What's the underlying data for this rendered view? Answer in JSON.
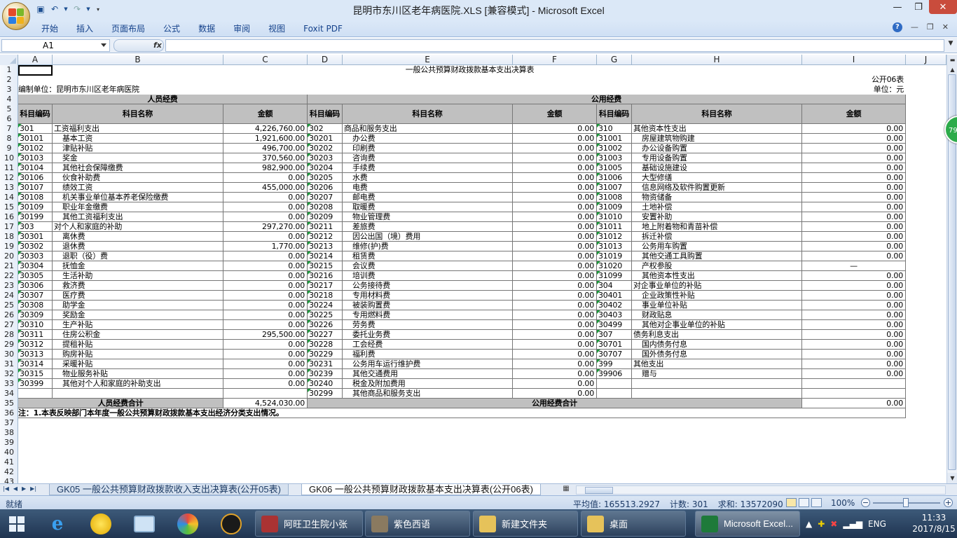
{
  "window": {
    "title": "昆明市东川区老年病医院.XLS  [兼容模式] - Microsoft Excel"
  },
  "ribbon": {
    "tabs": [
      "开始",
      "插入",
      "页面布局",
      "公式",
      "数据",
      "审阅",
      "视图",
      "Foxit PDF"
    ]
  },
  "formula": {
    "namebox": "A1",
    "fx": "fx",
    "content": ""
  },
  "columns": [
    "A",
    "B",
    "C",
    "D",
    "E",
    "F",
    "G",
    "H",
    "I",
    "J"
  ],
  "rows_visible": [
    "1",
    "2",
    "3",
    "4",
    "5",
    "6",
    "7",
    "8",
    "9",
    "10",
    "11",
    "12",
    "13",
    "14",
    "15",
    "16",
    "17",
    "18",
    "19",
    "20",
    "21",
    "22",
    "23",
    "24",
    "25",
    "26",
    "27",
    "28",
    "29",
    "30",
    "31",
    "32",
    "33",
    "34",
    "35",
    "36",
    "37",
    "38",
    "39",
    "40",
    "41",
    "42",
    "43"
  ],
  "sheet": {
    "title": "一般公共预算财政拨款基本支出决算表",
    "form_no": "公开06表",
    "unit_label": "编制单位：昆明市东川区老年病医院",
    "unit_of_measure": "单位：元",
    "personnel_header": "人员经费",
    "public_header": "公用经费",
    "col_code": "科目编码",
    "col_name": "科目名称",
    "col_amount": "金额",
    "personnel_total_label": "人员经费合计",
    "personnel_total": "4,524,030.00",
    "public_total_label": "公用经费合计",
    "public_total": "0.00",
    "note": "注：1.本表反映部门本年度一般公共预算财政拨款基本支出经济分类支出情况。",
    "rows": [
      [
        [
          "301",
          "工资福利支出",
          "4,226,760.00"
        ],
        [
          "302",
          "商品和服务支出",
          "0.00"
        ],
        [
          "310",
          "其他资本性支出",
          "0.00"
        ]
      ],
      [
        [
          "30101",
          "基本工资",
          "1,921,600.00"
        ],
        [
          "30201",
          "办公费",
          "0.00"
        ],
        [
          "31001",
          "房屋建筑物购建",
          "0.00"
        ]
      ],
      [
        [
          "30102",
          "津贴补贴",
          "496,700.00"
        ],
        [
          "30202",
          "印刷费",
          "0.00"
        ],
        [
          "31002",
          "办公设备购置",
          "0.00"
        ]
      ],
      [
        [
          "30103",
          "奖金",
          "370,560.00"
        ],
        [
          "30203",
          "咨询费",
          "0.00"
        ],
        [
          "31003",
          "专用设备购置",
          "0.00"
        ]
      ],
      [
        [
          "30104",
          "其他社会保障缴费",
          "982,900.00"
        ],
        [
          "30204",
          "手续费",
          "0.00"
        ],
        [
          "31005",
          "基础设施建设",
          "0.00"
        ]
      ],
      [
        [
          "30106",
          "伙食补助费",
          "0.00"
        ],
        [
          "30205",
          "水费",
          "0.00"
        ],
        [
          "31006",
          "大型修缮",
          "0.00"
        ]
      ],
      [
        [
          "30107",
          "绩效工资",
          "455,000.00"
        ],
        [
          "30206",
          "电费",
          "0.00"
        ],
        [
          "31007",
          "信息网络及软件购置更新",
          "0.00"
        ]
      ],
      [
        [
          "30108",
          "机关事业单位基本养老保险缴费",
          "0.00"
        ],
        [
          "30207",
          "邮电费",
          "0.00"
        ],
        [
          "31008",
          "物资储备",
          "0.00"
        ]
      ],
      [
        [
          "30109",
          "职业年金缴费",
          "0.00"
        ],
        [
          "30208",
          "取暖费",
          "0.00"
        ],
        [
          "31009",
          "土地补偿",
          "0.00"
        ]
      ],
      [
        [
          "30199",
          "其他工资福利支出",
          "0.00"
        ],
        [
          "30209",
          "物业管理费",
          "0.00"
        ],
        [
          "31010",
          "安置补助",
          "0.00"
        ]
      ],
      [
        [
          "303",
          "对个人和家庭的补助",
          "297,270.00"
        ],
        [
          "30211",
          "差旅费",
          "0.00"
        ],
        [
          "31011",
          "地上附着物和青苗补偿",
          "0.00"
        ]
      ],
      [
        [
          "30301",
          "离休费",
          "0.00"
        ],
        [
          "30212",
          "因公出国（境）费用",
          "0.00"
        ],
        [
          "31012",
          "拆迁补偿",
          "0.00"
        ]
      ],
      [
        [
          "30302",
          "退休费",
          "1,770.00"
        ],
        [
          "30213",
          "维修(护)费",
          "0.00"
        ],
        [
          "31013",
          "公务用车购置",
          "0.00"
        ]
      ],
      [
        [
          "30303",
          "退职（役）费",
          "0.00"
        ],
        [
          "30214",
          "租赁费",
          "0.00"
        ],
        [
          "31019",
          "其他交通工具购置",
          "0.00"
        ]
      ],
      [
        [
          "30304",
          "抚恤金",
          "0.00"
        ],
        [
          "30215",
          "会议费",
          "0.00"
        ],
        [
          "31020",
          "产权参股",
          "—"
        ]
      ],
      [
        [
          "30305",
          "生活补助",
          "0.00"
        ],
        [
          "30216",
          "培训费",
          "0.00"
        ],
        [
          "31099",
          "其他资本性支出",
          "0.00"
        ]
      ],
      [
        [
          "30306",
          "救济费",
          "0.00"
        ],
        [
          "30217",
          "公务接待费",
          "0.00"
        ],
        [
          "304",
          "对企事业单位的补贴",
          "0.00"
        ]
      ],
      [
        [
          "30307",
          "医疗费",
          "0.00"
        ],
        [
          "30218",
          "专用材料费",
          "0.00"
        ],
        [
          "30401",
          "企业政策性补贴",
          "0.00"
        ]
      ],
      [
        [
          "30308",
          "助学金",
          "0.00"
        ],
        [
          "30224",
          "被装购置费",
          "0.00"
        ],
        [
          "30402",
          "事业单位补贴",
          "0.00"
        ]
      ],
      [
        [
          "30309",
          "奖励金",
          "0.00"
        ],
        [
          "30225",
          "专用燃料费",
          "0.00"
        ],
        [
          "30403",
          "财政贴息",
          "0.00"
        ]
      ],
      [
        [
          "30310",
          "生产补贴",
          "0.00"
        ],
        [
          "30226",
          "劳务费",
          "0.00"
        ],
        [
          "30499",
          "其他对企事业单位的补贴",
          "0.00"
        ]
      ],
      [
        [
          "30311",
          "住房公积金",
          "295,500.00"
        ],
        [
          "30227",
          "委托业务费",
          "0.00"
        ],
        [
          "307",
          "债务利息支出",
          "0.00"
        ]
      ],
      [
        [
          "30312",
          "提租补贴",
          "0.00"
        ],
        [
          "30228",
          "工会经费",
          "0.00"
        ],
        [
          "30701",
          "国内债务付息",
          "0.00"
        ]
      ],
      [
        [
          "30313",
          "购房补贴",
          "0.00"
        ],
        [
          "30229",
          "福利费",
          "0.00"
        ],
        [
          "30707",
          "国外债务付息",
          "0.00"
        ]
      ],
      [
        [
          "30314",
          "采暖补贴",
          "0.00"
        ],
        [
          "30231",
          "公务用车运行维护费",
          "0.00"
        ],
        [
          "399",
          "其他支出",
          "0.00"
        ]
      ],
      [
        [
          "30315",
          "物业服务补贴",
          "0.00"
        ],
        [
          "30239",
          "其他交通费用",
          "0.00"
        ],
        [
          "39906",
          "赠与",
          "0.00"
        ]
      ],
      [
        [
          "30399",
          "其他对个人和家庭的补助支出",
          "0.00"
        ],
        [
          "30240",
          "税金及附加费用",
          "0.00"
        ],
        [
          "",
          "",
          " "
        ]
      ],
      [
        [
          "",
          "",
          ""
        ],
        [
          "30299",
          "其他商品和服务支出",
          "0.00"
        ],
        [
          "",
          "",
          ""
        ]
      ]
    ]
  },
  "sheet_tabs": [
    "GK05 一般公共预算财政拨款收入支出决算表(公开05表)",
    "GK06 一般公共预算财政拨款基本支出决算表(公开06表)"
  ],
  "status": {
    "ready": "就绪",
    "average": "平均值: 165513.2927",
    "count": "计数: 301",
    "sum": "求和: 13572090",
    "zoom": "100%"
  },
  "side_badge": "79",
  "taskbar": {
    "items": [
      "阿旺卫生院小张",
      "紫色西语",
      "新建文件夹",
      "桌面",
      "Microsoft Excel..."
    ],
    "lang": "ENG",
    "time": "11:33",
    "date": "2017/8/15"
  }
}
